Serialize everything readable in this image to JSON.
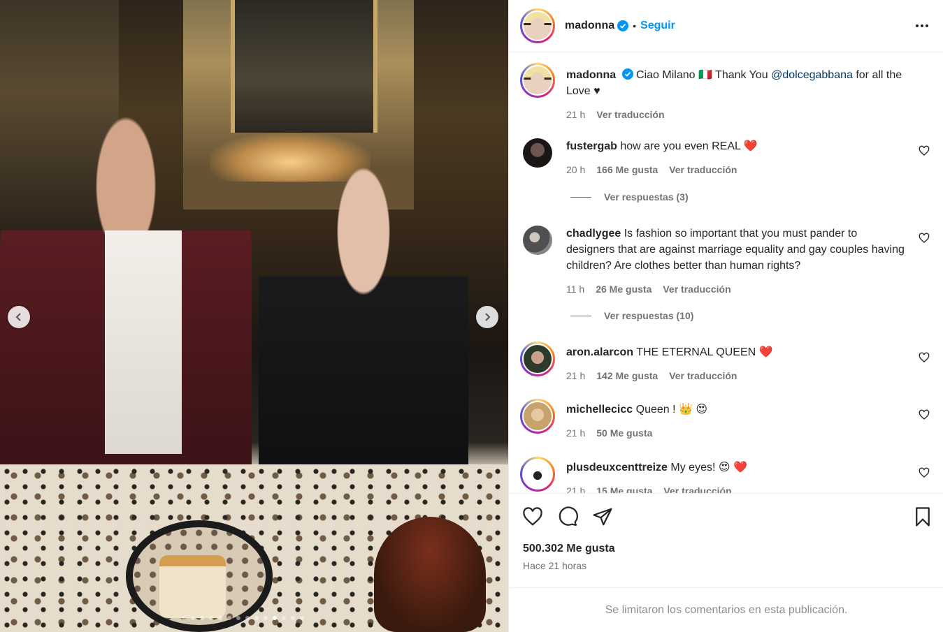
{
  "post": {
    "username": "madonna",
    "follow_label": "Seguir",
    "separator": "•"
  },
  "caption": {
    "username": "madonna",
    "text_before": "Ciao Milano 🇮🇹 Thank You ",
    "mention": "@dolcegabbana",
    "text_after": " for all the Love ♥",
    "time": "21 h",
    "translate": "Ver traducción"
  },
  "comments": [
    {
      "username": "fustergab",
      "text": "how are you even REAL",
      "emoji": "❤️",
      "time": "20 h",
      "likes": "166 Me gusta",
      "translate": "Ver traducción",
      "replies": "Ver respuestas (3)"
    },
    {
      "username": "chadlygee",
      "text": "Is fashion so important that you must pander to designers that are against marriage equality and gay couples having children? Are clothes better than human rights?",
      "emoji": "",
      "time": "11 h",
      "likes": "26 Me gusta",
      "translate": "Ver traducción",
      "replies": "Ver respuestas (10)"
    },
    {
      "username": "aron.alarcon",
      "text": "THE ETERNAL QUEEN",
      "emoji": "❤️",
      "time": "21 h",
      "likes": "142 Me gusta",
      "translate": "Ver traducción",
      "replies": ""
    },
    {
      "username": "michellecicc",
      "text": "Queen !",
      "emoji": "👑 😍",
      "time": "21 h",
      "likes": "50 Me gusta",
      "translate": "",
      "replies": ""
    },
    {
      "username": "plusdeuxcenttreize",
      "text": "My eyes!",
      "emoji": "😍 ❤️",
      "time": "21 h",
      "likes": "15 Me gusta",
      "translate": "Ver traducción",
      "replies": ""
    }
  ],
  "actions": {
    "likes_count": "500.302 Me gusta",
    "posted_ago": "Hace 21 horas"
  },
  "footer": {
    "comments_limited": "Se limitaron los comentarios en esta publicación."
  },
  "carousel": {
    "dot_count": 14,
    "active_index": 10
  },
  "colors": {
    "accent": "#0095f6",
    "text": "#262626",
    "secondary": "#737373",
    "like_red": "#e0245e"
  }
}
